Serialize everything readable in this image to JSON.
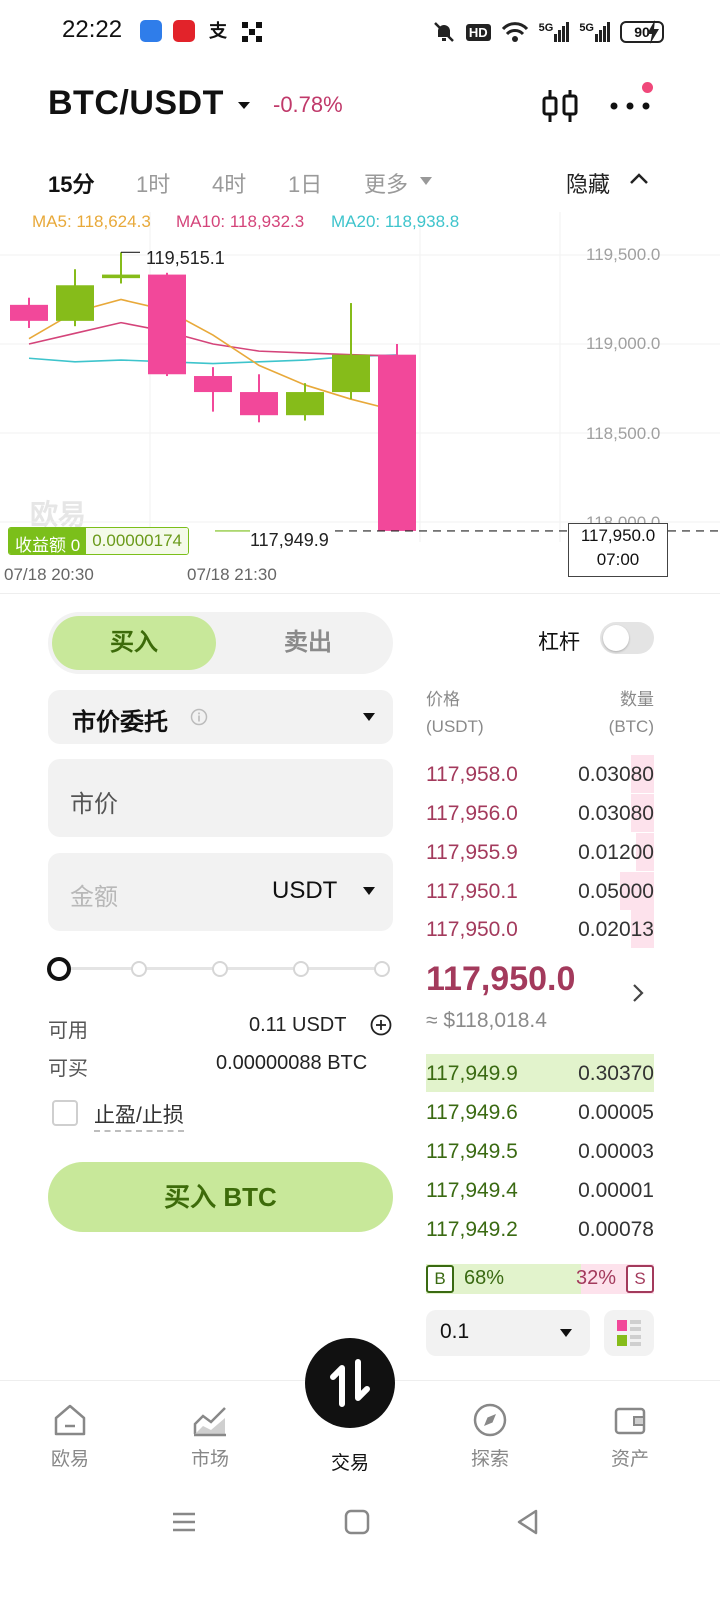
{
  "status_bar": {
    "time": "22:22",
    "app_badges": [
      "blue-app-icon",
      "weibo-app-icon",
      "alipay-app-icon",
      "okx-app-icon"
    ],
    "network": "HD",
    "signal1": "5G",
    "signal2": "5G",
    "battery": "90"
  },
  "header": {
    "pair": "BTC/USDT",
    "change": "-0.78%",
    "change_color": "#c0396a"
  },
  "timeframes": {
    "items": [
      "15分",
      "1时",
      "4时",
      "1日",
      "更多"
    ],
    "active": "15分",
    "hide_label": "隐藏"
  },
  "chart_data": {
    "type": "candlestick",
    "ma_legend": {
      "ma5": "MA5: 118,624.3",
      "ma10": "MA10: 118,932.3",
      "ma20": "MA20: 118,938.8"
    },
    "y_ticks": [
      "119,500.0",
      "119,000.0",
      "118,500.0",
      "118,000.0"
    ],
    "y_tick_values": [
      119500,
      119000,
      118500,
      118000
    ],
    "x_ticks": [
      "07/18 20:30",
      "07/18 21:30"
    ],
    "high_label": "119,515.1",
    "last_price_label": "117,949.9",
    "current_price_box": {
      "price": "117,950.0",
      "countdown": "07:00"
    },
    "pnl_badge": {
      "label": "收益额 0",
      "value": "0.00000174"
    },
    "watermark": "欧易",
    "candles": [
      {
        "open": 119220,
        "close": 119130,
        "high": 119260,
        "low": 119090
      },
      {
        "open": 119130,
        "close": 119330,
        "high": 119420,
        "low": 119100
      },
      {
        "open": 119370,
        "close": 119390,
        "high": 119515.1,
        "low": 119340
      },
      {
        "open": 119390,
        "close": 118830,
        "high": 119400,
        "low": 118820
      },
      {
        "open": 118820,
        "close": 118730,
        "high": 118870,
        "low": 118620
      },
      {
        "open": 118730,
        "close": 118600,
        "high": 118830,
        "low": 118560
      },
      {
        "open": 118600,
        "close": 118730,
        "high": 118780,
        "low": 118570
      },
      {
        "open": 118730,
        "close": 118940,
        "high": 119230,
        "low": 118690
      },
      {
        "open": 118940,
        "close": 117949.9,
        "high": 119000,
        "low": 117949.9
      }
    ],
    "ma5": [
      119030,
      119180,
      119250,
      119190,
      119050,
      118880,
      118770,
      118690,
      118624.3
    ],
    "ma10": [
      119000,
      119060,
      119120,
      119070,
      119000,
      118960,
      118950,
      118940,
      118932.3
    ],
    "ma20": [
      118920,
      118900,
      118910,
      118900,
      118890,
      118900,
      118910,
      118930,
      118938.8
    ],
    "colors": {
      "up": "#86bc1a",
      "down": "#f2489a",
      "ma5": "#e8a93a",
      "ma10": "#d4447a",
      "ma20": "#3ec4cc"
    }
  },
  "order_form": {
    "buy_label": "买入",
    "sell_label": "卖出",
    "leverage_label": "杠杆",
    "order_type": "市价委托",
    "price_field": "市价",
    "amount_placeholder": "金额",
    "amount_unit": "USDT",
    "slider_value_percent": 0,
    "available_label": "可用",
    "available_value": "0.11 USDT",
    "buyable_label": "可买",
    "buyable_value": "0.00000088 BTC",
    "tpsl_label": "止盈/止损",
    "submit_label": "买入 BTC",
    "accent": "#c8e89a"
  },
  "order_book": {
    "price_header": "价格",
    "price_unit": "(USDT)",
    "qty_header": "数量",
    "qty_unit": "(BTC)",
    "asks": [
      {
        "price": "117,958.0",
        "qty": "0.03080",
        "depth": 0.1
      },
      {
        "price": "117,956.0",
        "qty": "0.03080",
        "depth": 0.1
      },
      {
        "price": "117,955.9",
        "qty": "0.01200",
        "depth": 0.08
      },
      {
        "price": "117,950.1",
        "qty": "0.05000",
        "depth": 0.15
      },
      {
        "price": "117,950.0",
        "qty": "0.02013",
        "depth": 0.1
      }
    ],
    "mid_price": "117,950.0",
    "mid_fiat": "≈ $118,018.4",
    "bids": [
      {
        "price": "117,949.9",
        "qty": "0.30370",
        "depth": 1.0
      },
      {
        "price": "117,949.6",
        "qty": "0.00005",
        "depth": 0
      },
      {
        "price": "117,949.5",
        "qty": "0.00003",
        "depth": 0
      },
      {
        "price": "117,949.4",
        "qty": "0.00001",
        "depth": 0
      },
      {
        "price": "117,949.2",
        "qty": "0.00078",
        "depth": 0
      }
    ],
    "ratio_b_tag": "B",
    "ratio_b": "68%",
    "ratio_s": "32%",
    "ratio_s_tag": "S",
    "ratio_b_fraction": 0.68,
    "depth_step": "0.1"
  },
  "bottom_nav": {
    "items": [
      "欧易",
      "市场",
      "交易",
      "探索",
      "资产"
    ],
    "active": "交易"
  }
}
